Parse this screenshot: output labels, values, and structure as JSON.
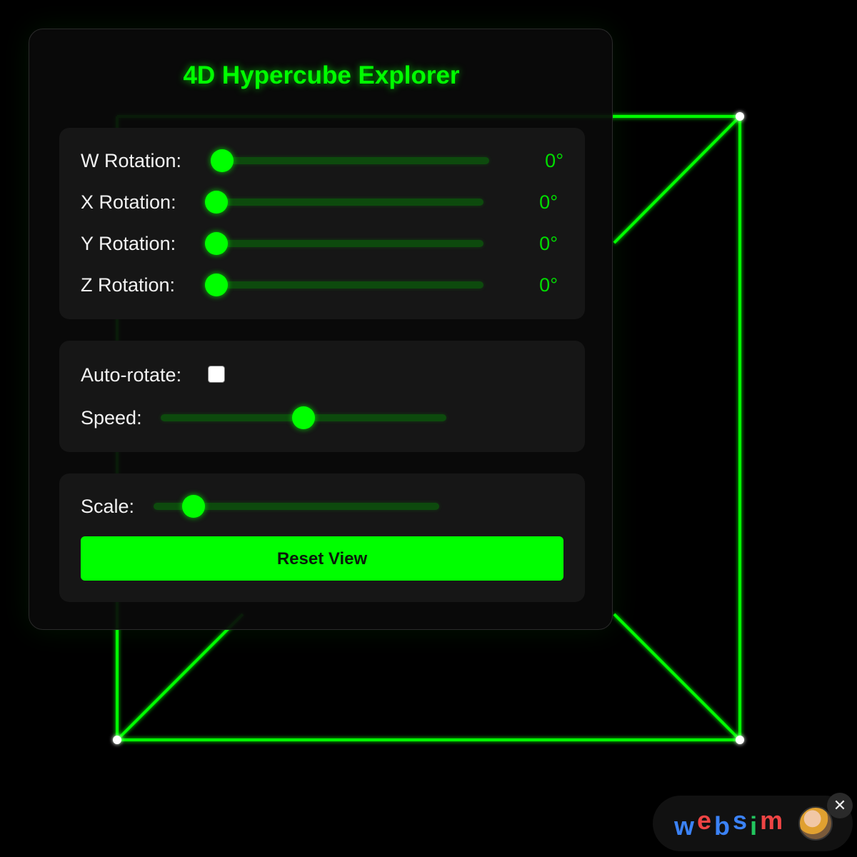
{
  "panel": {
    "title": "4D Hypercube Explorer"
  },
  "rotation": {
    "w": {
      "label": "W Rotation:",
      "value": "0°",
      "slider": 0
    },
    "x": {
      "label": "X Rotation:",
      "value": "0°",
      "slider": 0
    },
    "y": {
      "label": "Y Rotation:",
      "value": "0°",
      "slider": 0
    },
    "z": {
      "label": "Z Rotation:",
      "value": "0°",
      "slider": 0
    }
  },
  "animation": {
    "auto_rotate_label": "Auto-rotate:",
    "auto_rotate_checked": false,
    "speed_label": "Speed:",
    "speed_fraction": 0.5
  },
  "view": {
    "scale_label": "Scale:",
    "scale_fraction": 0.14,
    "reset_label": "Reset View"
  },
  "badge": {
    "brand_letters": [
      "w",
      "e",
      "b",
      "s",
      "i",
      "m"
    ],
    "brand_colors": [
      "#3b82f6",
      "#ef4444",
      "#3b82f6",
      "#3b82f6",
      "#22c55e",
      "#ef4444"
    ],
    "close_glyph": "✕"
  },
  "colors": {
    "accent": "#00ff00",
    "background": "#000000"
  }
}
